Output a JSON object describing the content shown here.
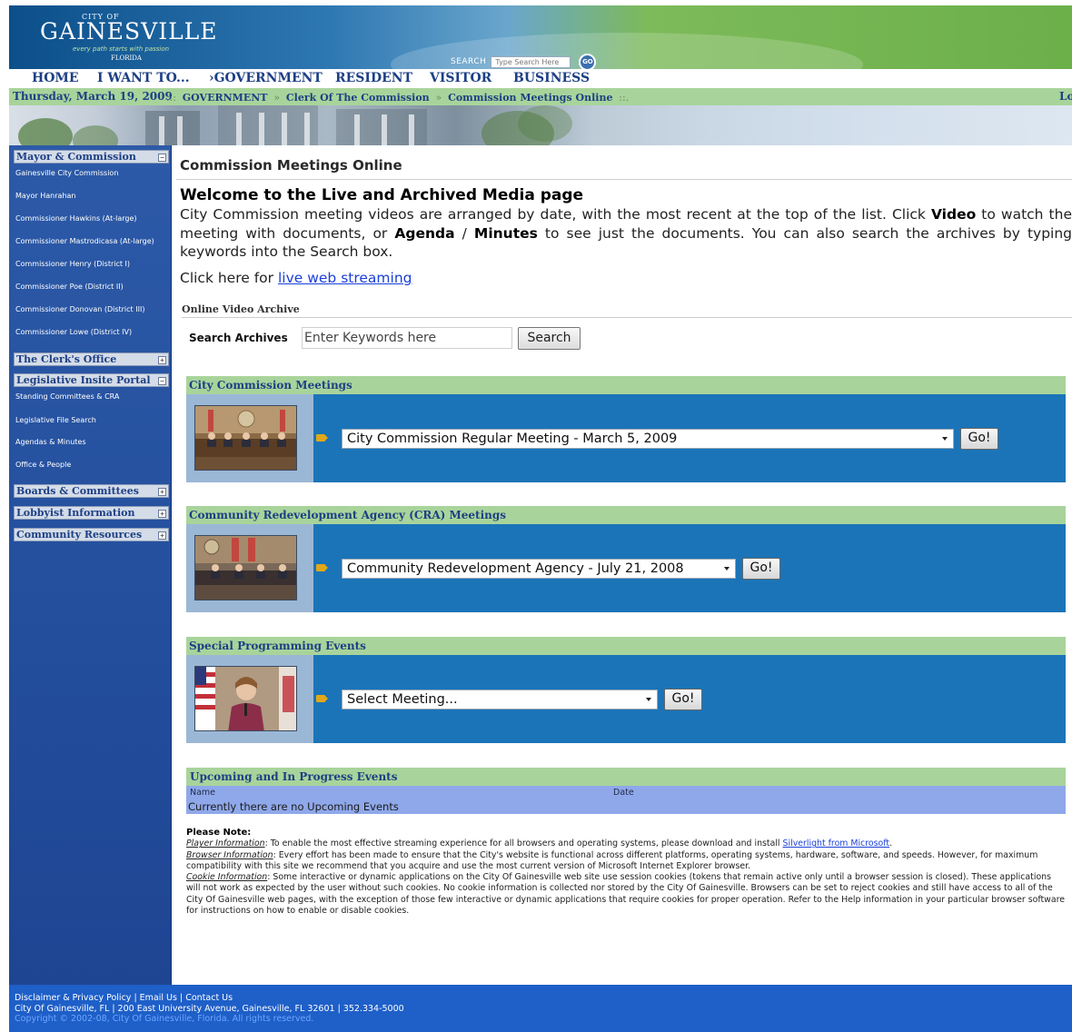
{
  "header": {
    "logo": {
      "city_of": "CITY OF",
      "name": "GAINESVILLE",
      "tagline": "every path starts with passion",
      "state": "FLORIDA"
    },
    "search": {
      "label": "SEARCH",
      "placeholder": "Type Search Here",
      "go_label": "GO"
    }
  },
  "nav": {
    "items": [
      {
        "label": "HOME"
      },
      {
        "label": "I WANT TO..."
      },
      {
        "label": "›GOVERNMENT"
      },
      {
        "label": "RESIDENT"
      },
      {
        "label": "VISITOR"
      },
      {
        "label": "BUSINESS"
      }
    ]
  },
  "breadcrumb": {
    "date": "Thursday, March 19, 2009",
    "lead_sep": ".::",
    "items": [
      "GOVERNMENT",
      "Clerk Of The Commission",
      "Commission Meetings Online"
    ],
    "sep": "»",
    "trail_sep": "::.",
    "login": "Logi"
  },
  "sidebar": {
    "sections": [
      {
        "title": "Mayor & Commission",
        "toggle": "−",
        "links": [
          "Gainesville City Commission",
          "Mayor Hanrahan",
          "Commissioner Hawkins (At-large)",
          "Commissioner Mastrodicasa (At-large)",
          "Commissioner Henry (District I)",
          "Commissioner Poe (District II)",
          "Commissioner Donovan (District III)",
          "Commissioner Lowe (District IV)"
        ]
      },
      {
        "title": "The Clerk's Office",
        "toggle": "+",
        "links": []
      },
      {
        "title": "Legislative Insite Portal",
        "toggle": "−",
        "links": [
          "Standing Committees & CRA",
          "Legislative File Search",
          "Agendas & Minutes",
          "Office & People"
        ]
      },
      {
        "title": "Boards & Committees",
        "toggle": "+",
        "links": []
      },
      {
        "title": "Lobbyist Information",
        "toggle": "+",
        "links": []
      },
      {
        "title": "Community Resources",
        "toggle": "+",
        "links": []
      }
    ]
  },
  "main": {
    "title": "Commission Meetings Online",
    "welcome_heading": "Welcome to the Live and Archived Media page",
    "welcome_text": {
      "p1": "City Commission meeting videos are arranged by date, with the most recent at the top of the list. Click ",
      "video": "Video",
      "p2": " to watch the meeting with documents, or ",
      "agenda": "Agenda",
      "p3": " / ",
      "minutes": "Minutes",
      "p4": " to see just the documents. You can also search the archives by typing keywords into the Search box."
    },
    "stream_prefix": "Click here for ",
    "stream_link": "live web streaming",
    "archive_label": "Online Video Archive",
    "search_archives_label": "Search Archives",
    "keyword_value": "Enter Keywords here",
    "search_button": "Search",
    "sections": [
      {
        "title": "City Commission Meetings",
        "selected": "City Commission Regular Meeting - March 5, 2009",
        "go": "Go!"
      },
      {
        "title": "Community Redevelopment Agency (CRA) Meetings",
        "selected": "Community Redevelopment Agency - July 21, 2008",
        "go": "Go!"
      },
      {
        "title": "Special Programming Events",
        "selected": "Select Meeting...",
        "go": "Go!"
      }
    ],
    "upcoming": {
      "title": "Upcoming and In Progress Events",
      "col_name": "Name",
      "col_date": "Date",
      "empty": "Currently there are no Upcoming Events"
    },
    "note": {
      "title": "Please Note:",
      "player_key": "Player Information",
      "player_text": ": To enable the most effective streaming experience for all browsers and operating systems, please download and install ",
      "player_link": "Silverlight from Microsoft",
      "player_end": ".",
      "browser_key": "Browser Information",
      "browser_text": ": Every effort has been made to ensure that the City's website is functional across different platforms, operating systems, hardware, software, and speeds. However, for maximum compatibility with this site we recommend that you acquire and use the most current version of Microsoft Internet Explorer browser.",
      "cookie_key": "Cookie Information",
      "cookie_text": ": Some interactive or dynamic applications on the City Of Gainesville web site use session cookies (tokens that remain active only until a browser session is closed). These applications will not work as expected by the user without such cookies. No cookie information is collected nor stored by the City Of Gainesville. Browsers can be set to reject cookies and still have access to all of the City Of Gainesville web pages, with the exception of those few interactive or dynamic applications that require cookies for proper operation. Refer to the Help information in your particular browser software for instructions on how to enable or disable cookies."
    }
  },
  "footer": {
    "links": [
      "Disclaimer & Privacy Policy",
      "Email Us",
      "Contact Us"
    ],
    "sep": " | ",
    "address": "City Of Gainesville, FL | 200 East University Avenue, Gainesville, FL 32601 | 352.334-5000",
    "copyright": "Copyright © 2002-08, City Of Gainesville, Florida. All rights reserved."
  }
}
